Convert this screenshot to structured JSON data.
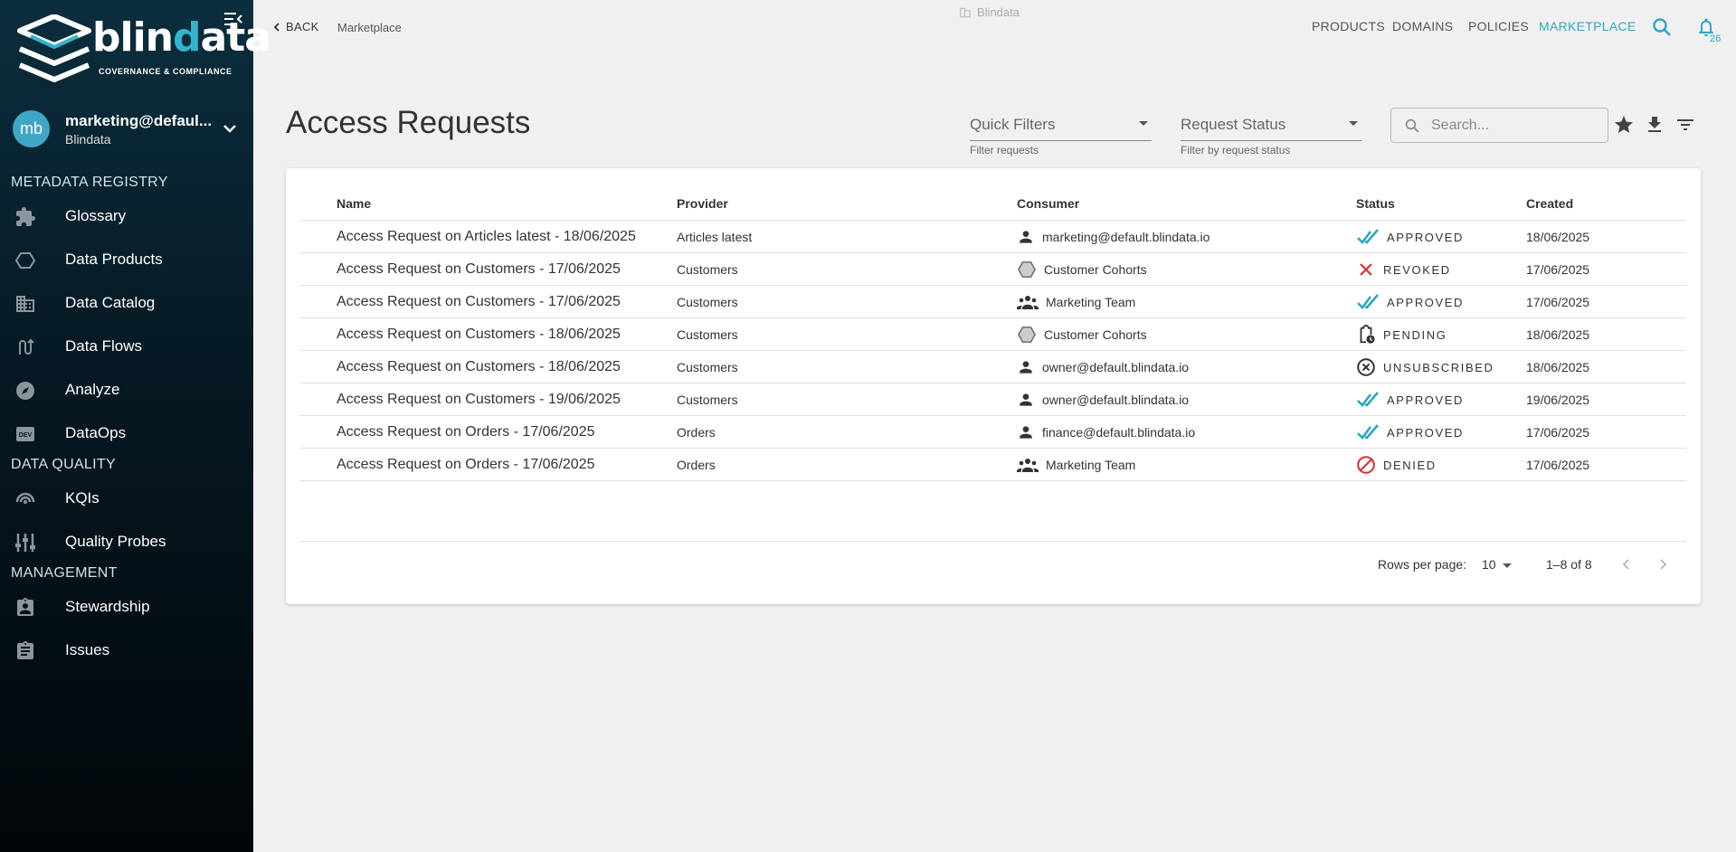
{
  "sidebar": {
    "logo_text_pre": "blin",
    "logo_text_accent": "d",
    "logo_text_post": "ata",
    "logo_subtitle": "COVERNANCE & COMPLIANCE",
    "account": {
      "initials": "mb",
      "user": "marketing@defaul...",
      "tenant": "Blindata"
    },
    "sections": [
      {
        "title": "METADATA REGISTRY"
      },
      {
        "title": "DATA QUALITY"
      },
      {
        "title": "MANAGEMENT"
      }
    ],
    "items": [
      {
        "label": "Glossary",
        "icon": "puzzle-icon"
      },
      {
        "label": "Data Products",
        "icon": "hexagon-icon"
      },
      {
        "label": "Data Catalog",
        "icon": "building-icon"
      },
      {
        "label": "Data Flows",
        "icon": "flow-icon"
      },
      {
        "label": "Analyze",
        "icon": "compass-icon"
      },
      {
        "label": "DataOps",
        "icon": "dev-icon"
      },
      {
        "label": "KQIs",
        "icon": "gauge-icon"
      },
      {
        "label": "Quality Probes",
        "icon": "probes-icon"
      },
      {
        "label": "Stewardship",
        "icon": "badge-icon"
      },
      {
        "label": "Issues",
        "icon": "clipboard-icon"
      }
    ]
  },
  "topbar": {
    "back_label": "BACK",
    "breadcrumb": "Marketplace",
    "tenant": "Blindata",
    "nav": [
      "PRODUCTS",
      "DOMAINS",
      "POLICIES",
      "MARKETPLACE"
    ],
    "active_nav": "MARKETPLACE",
    "notification_count": "26",
    "accent_color": "#2fa7c3"
  },
  "page": {
    "title": "Access Requests",
    "quick_filters": {
      "value": "Quick Filters",
      "helper": "Filter requests"
    },
    "request_status": {
      "value": "Request Status",
      "helper": "Filter by request status"
    },
    "search_placeholder": "Search..."
  },
  "table": {
    "columns": [
      "Name",
      "Provider",
      "Consumer",
      "Status",
      "Created"
    ],
    "rows": [
      {
        "name": "Access Request on Articles latest - 18/06/2025",
        "provider": "Articles latest",
        "consumer": "marketing@default.blindata.io",
        "consumer_icon": "person-icon",
        "status": "APPROVED",
        "status_icon": "approved-check-icon",
        "created": "18/06/2025"
      },
      {
        "name": "Access Request on Customers - 17/06/2025",
        "provider": "Customers",
        "consumer": "Customer Cohorts",
        "consumer_icon": "hexagon-icon",
        "status": "REVOKED",
        "status_icon": "revoked-x-icon",
        "created": "17/06/2025"
      },
      {
        "name": "Access Request on Customers - 17/06/2025",
        "provider": "Customers",
        "consumer": "Marketing Team",
        "consumer_icon": "group-icon",
        "status": "APPROVED",
        "status_icon": "approved-check-icon",
        "created": "17/06/2025"
      },
      {
        "name": "Access Request on Customers - 18/06/2025",
        "provider": "Customers",
        "consumer": "Customer Cohorts",
        "consumer_icon": "hexagon-icon",
        "status": "PENDING",
        "status_icon": "pending-clipboard-icon",
        "created": "18/06/2025"
      },
      {
        "name": "Access Request on Customers - 18/06/2025",
        "provider": "Customers",
        "consumer": "owner@default.blindata.io",
        "consumer_icon": "person-icon",
        "status": "UNSUBSCRIBED",
        "status_icon": "unsubscribed-circle-x-icon",
        "created": "18/06/2025"
      },
      {
        "name": "Access Request on Customers - 19/06/2025",
        "provider": "Customers",
        "consumer": "owner@default.blindata.io",
        "consumer_icon": "person-icon",
        "status": "APPROVED",
        "status_icon": "approved-check-icon",
        "created": "19/06/2025"
      },
      {
        "name": "Access Request on Orders - 17/06/2025",
        "provider": "Orders",
        "consumer": "finance@default.blindata.io",
        "consumer_icon": "person-icon",
        "status": "APPROVED",
        "status_icon": "approved-check-icon",
        "created": "17/06/2025"
      },
      {
        "name": "Access Request on Orders - 17/06/2025",
        "provider": "Orders",
        "consumer": "Marketing Team",
        "consumer_icon": "group-icon",
        "status": "DENIED",
        "status_icon": "denied-block-icon",
        "created": "17/06/2025"
      }
    ],
    "status_colors": {
      "approved": "#2fa7c3",
      "revoked": "#d32f2f",
      "denied": "#d32f2f"
    }
  },
  "pagination": {
    "rows_per_page_label": "Rows per page:",
    "rows_per_page": "10",
    "range": "1–8 of 8"
  }
}
